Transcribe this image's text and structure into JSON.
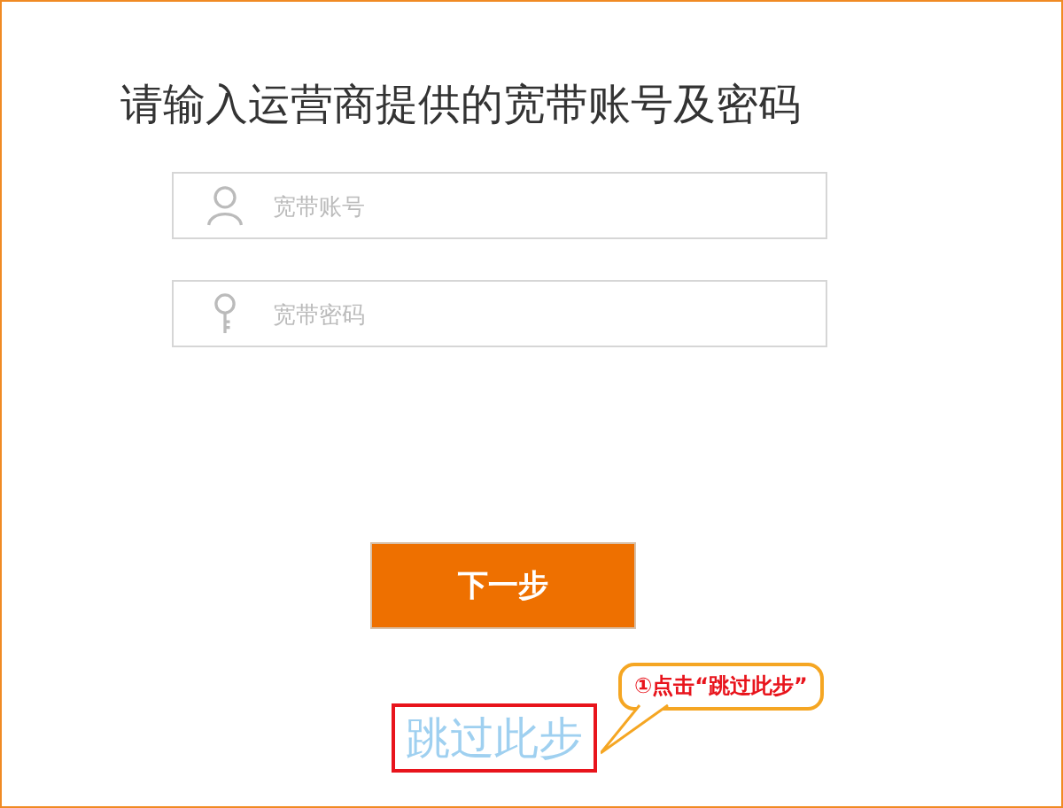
{
  "title": "请输入运营商提供的宽带账号及密码",
  "fields": [
    {
      "kind": "account",
      "placeholder": "宽带账号"
    },
    {
      "kind": "password",
      "placeholder": "宽带密码"
    }
  ],
  "next_button": "下一步",
  "skip_link": {
    "label": "跳过此步",
    "highlighted": true
  },
  "annotation": "①点击“跳过此步”"
}
